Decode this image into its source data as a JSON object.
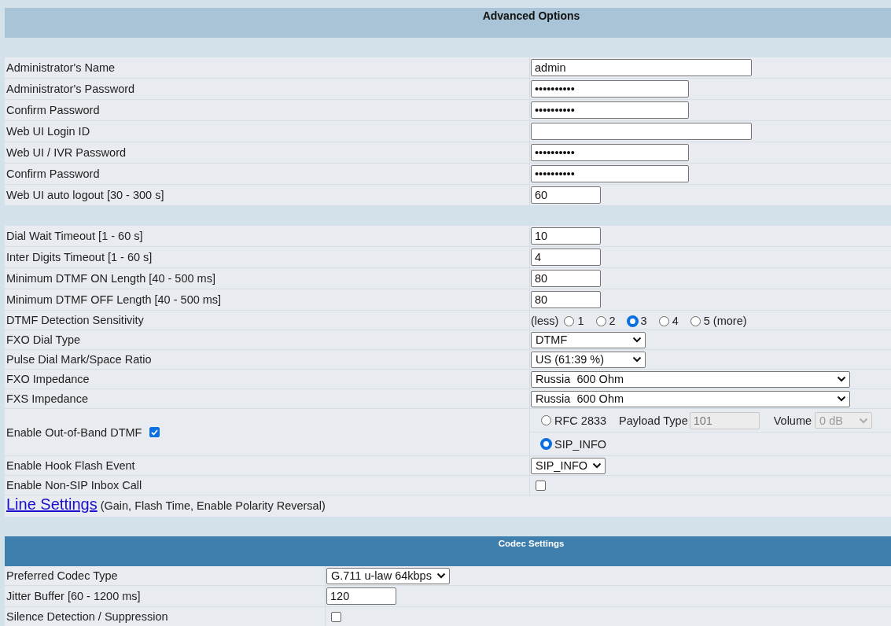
{
  "advanced": {
    "title": "Advanced Options",
    "groups": [
      [
        {
          "kind": "text",
          "label": "Administrator's Name",
          "value": "admin"
        },
        {
          "kind": "password",
          "label": "Administrator's Password",
          "value": "••••••••••"
        },
        {
          "kind": "password",
          "label": "Confirm Password",
          "value": "••••••••••"
        },
        {
          "kind": "text",
          "label": "Web UI Login ID"
        },
        {
          "kind": "password",
          "label": "Web UI / IVR Password",
          "value": "••••••••••"
        },
        {
          "kind": "password",
          "label": "Confirm Password",
          "value": "••••••••••"
        },
        {
          "kind": "number",
          "label": "Web UI auto logout [30 - 300 s]",
          "value": "60"
        }
      ],
      [
        {
          "kind": "number",
          "label": "Dial Wait Timeout [1 - 60 s]",
          "value": "10"
        },
        {
          "kind": "number",
          "label": "Inter Digits Timeout [1 - 60 s]",
          "value": "4"
        },
        {
          "kind": "number",
          "label": "Minimum DTMF ON Length [40 - 500 ms]",
          "value": "80"
        },
        {
          "kind": "number",
          "label": "Minimum DTMF OFF Length [40 - 500 ms]",
          "value": "80"
        },
        {
          "kind": "radios",
          "label": "DTMF Detection Sensitivity",
          "prefix": "(less)",
          "options": [
            {
              "label": "1",
              "selected": false
            },
            {
              "label": "2",
              "selected": false
            },
            {
              "label": "3",
              "selected": true
            },
            {
              "label": "4",
              "selected": false
            },
            {
              "label": "5 (more)",
              "selected": false
            }
          ]
        },
        {
          "kind": "select",
          "label": "FXO Dial Type",
          "value": "DTMF"
        },
        {
          "kind": "select",
          "label": "Pulse Dial Mark/Space Ratio",
          "value": "US (61:39 %)"
        },
        {
          "kind": "select-wide",
          "label": "FXO Impedance",
          "value": "Russia  600 Ohm"
        },
        {
          "kind": "select-wide",
          "label": "FXS Impedance",
          "value": "Russia  600 Ohm"
        },
        {
          "kind": "dtmf-mode",
          "label": "Enable Out-of-Band DTMF",
          "checked": true,
          "options": [
            {
              "label": "RFC 2833",
              "selected": false
            },
            {
              "label": "SIP_INFO",
              "selected": true
            }
          ],
          "payload_label": "Payload Type",
          "payload_value": "101",
          "volume_label": "Volume",
          "volume_value": "0 dB"
        },
        {
          "kind": "select-small",
          "label": "Enable Hook Flash Event",
          "value": "SIP_INFO"
        },
        {
          "kind": "checkbox",
          "label": "Enable Non-SIP Inbox Call",
          "checked": false
        }
      ]
    ],
    "line_settings": {
      "link": "Line Settings",
      "note": "(Gain, Flash Time, Enable Polarity Reversal)"
    }
  },
  "codec": {
    "title": "Codec Settings",
    "rows": [
      {
        "kind": "select-small",
        "label": "Preferred Codec Type",
        "value": "G.711 u-law 64kbps"
      },
      {
        "kind": "number",
        "label": "Jitter Buffer [60 - 1200 ms]",
        "value": "120"
      },
      {
        "kind": "checkbox",
        "label": "Silence Detection / Suppression",
        "checked": false
      }
    ]
  }
}
